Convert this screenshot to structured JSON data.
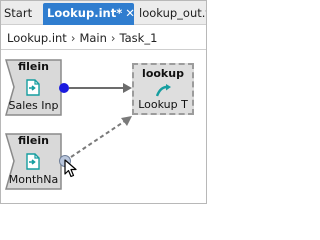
{
  "tabs": [
    {
      "label": "Start"
    },
    {
      "label": "Lookup.int*",
      "close": "✕"
    },
    {
      "label": "lookup_out.t"
    }
  ],
  "breadcrumb": [
    "Lookup.int",
    "Main",
    "Task_1"
  ],
  "breadcrumb_separator": "›",
  "nodes": {
    "filein_top": {
      "title": "filein",
      "label": "Sales Inp"
    },
    "filein_bottom": {
      "title": "filein",
      "label": "MonthNa"
    },
    "lookup": {
      "title": "lookup",
      "label": "Lookup T"
    }
  },
  "colors": {
    "active_tab": "#2f7dcf",
    "port": "#1a1adf",
    "solid_link": "#6c6c6c",
    "dashed_link": "#7a7a7a",
    "icon_teal": "#169ea0"
  },
  "icons": [
    "file-input-icon",
    "lookup-transform-icon",
    "mouse-pointer-icon"
  ]
}
